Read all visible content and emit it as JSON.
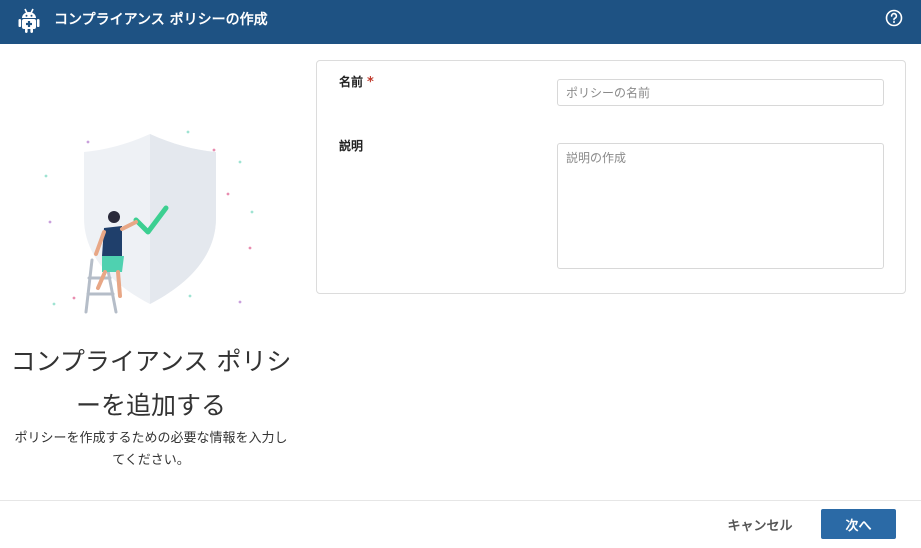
{
  "window": {
    "title": "コンプライアンス ポリシーの作成"
  },
  "icons": {
    "app": "android-robot-icon",
    "help": "help-circle-icon",
    "illustration": "shield-checkmark-person-on-ladder-illustration"
  },
  "left_panel": {
    "heading_line1": "コンプライアンス ポリシ",
    "heading_line2": "ーを追加する",
    "description_line1": "ポリシーを作成するための必要な情報を入力し",
    "description_line2": "てください。"
  },
  "form": {
    "name_label": "名前",
    "required_mark": "*",
    "name_value": "",
    "name_placeholder": "ポリシーの名前",
    "description_label": "説明",
    "description_value": "",
    "description_placeholder": "説明の作成"
  },
  "footer": {
    "cancel_label": "キャンセル",
    "next_label": "次へ"
  },
  "colors": {
    "titlebar": "#1e5283",
    "primary_button": "#2b6aa6",
    "required_star": "#c0392b",
    "check_mark": "#3ccf91"
  }
}
